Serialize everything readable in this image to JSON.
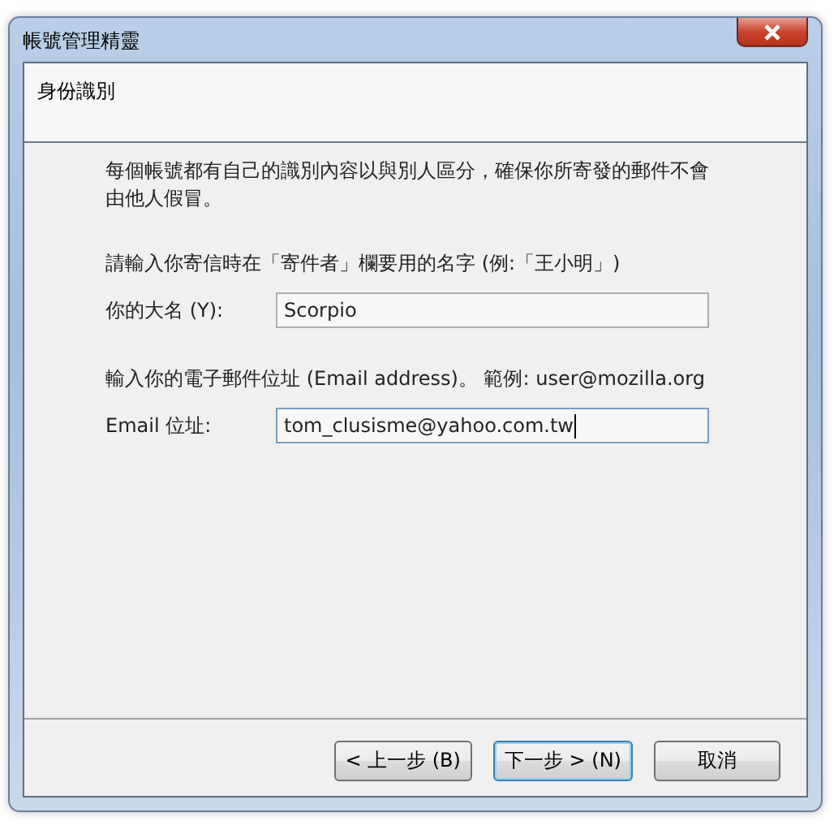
{
  "window": {
    "title": "帳號管理精靈"
  },
  "header": {
    "title": "身份識別"
  },
  "intro": "每個帳號都有自己的識別內容以與別人區分，確保你所寄發的郵件不會由他人假冒。",
  "fields": [
    {
      "prompt": "請輸入你寄信時在「寄件者」欄要用的名字 (例:「王小明」)",
      "label": "你的大名 (Y):",
      "value": "Scorpio",
      "focused": false
    },
    {
      "prompt": "輸入你的電子郵件位址 (Email address)。 範例: user@mozilla.org",
      "label": "Email 位址:",
      "value": "tom_clusisme@yahoo.com.tw",
      "focused": true
    }
  ],
  "buttons": [
    {
      "label": "< 上一步 (B)",
      "default": false
    },
    {
      "label": "下一步 > (N)",
      "default": true
    },
    {
      "label": "取消",
      "default": false
    }
  ]
}
